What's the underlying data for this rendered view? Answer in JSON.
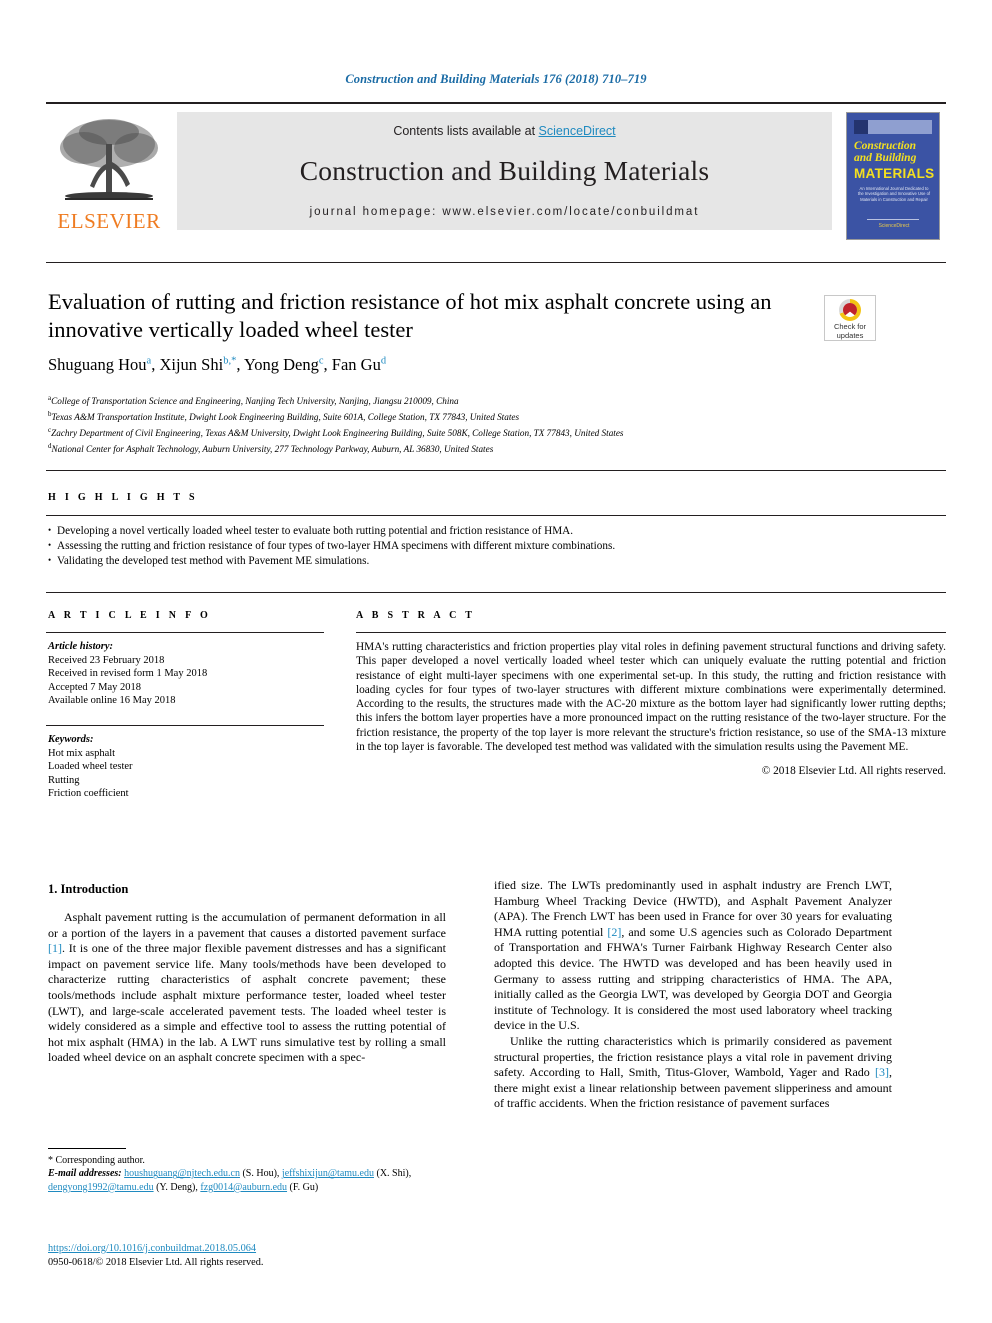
{
  "running_head": "Construction and Building Materials 176 (2018) 710–719",
  "masthead": {
    "publisher_name": "ELSEVIER",
    "contents_prefix": "Contents lists available at ",
    "sciencedirect_label": "ScienceDirect",
    "journal_title": "Construction and Building Materials",
    "homepage": "journal homepage: www.elsevier.com/locate/conbuildmat",
    "cover": {
      "line1": "Construction",
      "line2": "and Building",
      "line3": "MATERIALS",
      "subtitle": "An International Journal Dedicated to the Investigation and Innovative Use of Materials in Construction and Repair",
      "footer": "ScienceDirect"
    },
    "accent_color": "#1f8ac0",
    "elsevier_orange": "#ef7c22",
    "cover_blue": "#3b53a4"
  },
  "article": {
    "title": "Evaluation of rutting and friction resistance of hot mix asphalt concrete using an innovative vertically loaded wheel tester",
    "crossmark_label_line1": "Check for",
    "crossmark_label_line2": "updates",
    "authors_html": "Shuguang Hou<sup>a</sup>, Xijun Shi<sup>b,*</sup>, Yong Deng<sup>c</sup>, Fan Gu<sup>d</sup>",
    "affiliations": [
      {
        "marker": "a",
        "text": "College of Transportation Science and Engineering, Nanjing Tech University, Nanjing, Jiangsu 210009, China"
      },
      {
        "marker": "b",
        "text": "Texas A&M Transportation Institute, Dwight Look Engineering Building, Suite 601A, College Station, TX 77843, United States"
      },
      {
        "marker": "c",
        "text": "Zachry Department of Civil Engineering, Texas A&M University, Dwight Look Engineering Building, Suite 508K, College Station, TX 77843, United States"
      },
      {
        "marker": "d",
        "text": "National Center for Asphalt Technology, Auburn University, 277 Technology Parkway, Auburn, AL 36830, United States"
      }
    ]
  },
  "highlights": {
    "heading": "H I G H L I G H T S",
    "items": [
      "Developing a novel vertically loaded wheel tester to evaluate both rutting potential and friction resistance of HMA.",
      "Assessing the rutting and friction resistance of four types of two-layer HMA specimens with different mixture combinations.",
      "Validating the developed test method with Pavement ME simulations."
    ]
  },
  "article_info": {
    "heading": "A R T I C L E  I N F O",
    "history_label": "Article history:",
    "history": [
      "Received 23 February 2018",
      "Received in revised form 1 May 2018",
      "Accepted 7 May 2018",
      "Available online 16 May 2018"
    ],
    "keywords_label": "Keywords:",
    "keywords": [
      "Hot mix asphalt",
      "Loaded wheel tester",
      "Rutting",
      "Friction coefficient"
    ]
  },
  "abstract": {
    "heading": "A B S T R A C T",
    "text": "HMA's rutting characteristics and friction properties play vital roles in defining pavement structural functions and driving safety. This paper developed a novel vertically loaded wheel tester which can uniquely evaluate the rutting potential and friction resistance of eight multi-layer specimens with one experimental set-up. In this study, the rutting and friction resistance with loading cycles for four types of two-layer structures with different mixture combinations were experimentally determined. According to the results, the structures made with the AC-20 mixture as the bottom layer had significantly lower rutting depths; this infers the bottom layer properties have a more pronounced impact on the rutting resistance of the two-layer structure. For the friction resistance, the property of the top layer is more relevant the structure's friction resistance, so use of the SMA-13 mixture in the top layer is favorable. The developed test method was validated with the simulation results using the Pavement ME.",
    "copyright": "© 2018 Elsevier Ltd. All rights reserved."
  },
  "body": {
    "section_heading": "1. Introduction",
    "left_column": [
      "Asphalt pavement rutting is the accumulation of permanent deformation in all or a portion of the layers in a pavement that causes a distorted pavement surface [1]. It is one of the three major flexible pavement distresses and has a significant impact on pavement service life. Many tools/methods have been developed to characterize rutting characteristics of asphalt concrete pavement; these tools/methods include asphalt mixture performance tester, loaded wheel tester (LWT), and large-scale accelerated pavement tests. The loaded wheel tester is widely considered as a simple and effective tool to assess the rutting potential of hot mix asphalt (HMA) in the lab. A LWT runs simulative test by rolling a small loaded wheel device on an asphalt concrete specimen with a spec-"
    ],
    "right_column": [
      "ified size. The LWTs predominantly used in asphalt industry are French LWT, Hamburg Wheel Tracking Device (HWTD), and Asphalt Pavement Analyzer (APA). The French LWT has been used in France for over 30 years for evaluating HMA rutting potential [2], and some U.S agencies such as Colorado Department of Transportation and FHWA's Turner Fairbank Highway Research Center also adopted this device. The HWTD was developed and has been heavily used in Germany to assess rutting and stripping characteristics of HMA. The APA, initially called as the Georgia LWT, was developed by Georgia DOT and Georgia institute of Technology. It is considered the most used laboratory wheel tracking device in the U.S.",
      "Unlike the rutting characteristics which is primarily considered as pavement structural properties, the friction resistance plays a vital role in pavement driving safety. According to Hall, Smith, Titus-Glover, Wambold, Yager and Rado [3], there might exist a linear relationship between pavement slipperiness and amount of traffic accidents. When the friction resistance of pavement surfaces"
    ],
    "reference_markers": [
      "[1]",
      "[2]",
      "[3]"
    ]
  },
  "footnote": {
    "corresponding": "* Corresponding author.",
    "email_label": "E-mail addresses:",
    "emails": [
      {
        "address": "houshuguang@njtech.edu.cn",
        "name": "(S. Hou)"
      },
      {
        "address": "jeffshixijun@tamu.edu",
        "name": "(X. Shi)"
      },
      {
        "address": "dengyong1992@tamu.edu",
        "name": "(Y. Deng)"
      },
      {
        "address": "fzg0014@auburn.edu",
        "name": "(F. Gu)"
      }
    ],
    "doi": "https://doi.org/10.1016/j.conbuildmat.2018.05.064",
    "issn_line": "0950-0618/© 2018 Elsevier Ltd. All rights reserved."
  }
}
